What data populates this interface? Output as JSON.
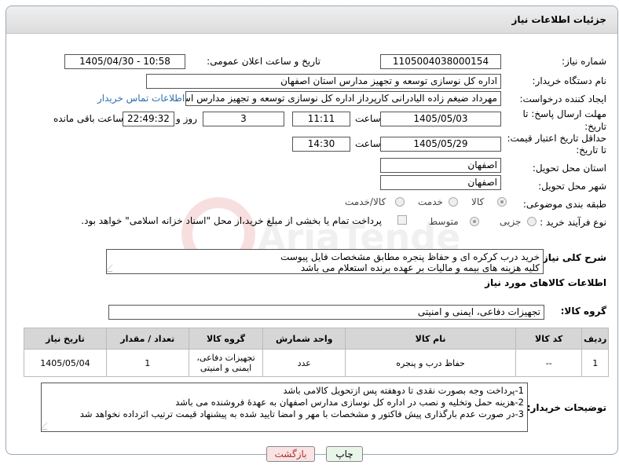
{
  "header": {
    "title": "جزئیات اطلاعات نیاز"
  },
  "fields": {
    "need_number_label": "شماره نیاز:",
    "need_number": "1105004038000154",
    "announce_label": "تاریخ و ساعت اعلان عمومی:",
    "announce_value": "1405/04/30 - 10:58",
    "buyer_org_label": "نام دستگاه خریدار:",
    "buyer_org": "اداره کل نوسازی  توسعه و تجهیز مدارس استان اصفهان",
    "creator_label": "ایجاد کننده درخواست:",
    "creator": "مهرداد ضیغم زاده الیادرانی کارپرداز اداره کل نوسازی  توسعه و تجهیز مدارس اس",
    "contact_link": "اطلاعات تماس خریدار",
    "reply_deadline_label_1": "مهلت ارسال پاسخ: تا",
    "reply_deadline_label_2": "تاریخ:",
    "reply_date": "1405/05/03",
    "time_label": "ساعت",
    "reply_time": "11:11",
    "days_value": "3",
    "days_label": "روز و",
    "remaining_time": "22:49:32",
    "remaining_label": "ساعت باقی مانده",
    "price_deadline_label_1": "حداقل تاریخ اعتبار قیمت:",
    "price_deadline_label_2": "تا تاریخ:",
    "price_date": "1405/05/29",
    "price_time_label": "ساعت",
    "price_time": "14:30",
    "province_label": "استان محل تحویل:",
    "province": "اصفهان",
    "city_label": "شهر محل تحویل:",
    "city": "اصفهان",
    "category_label": "طبقه بندی موضوعی:",
    "category_options": [
      "کالا",
      "خدمت",
      "کالا/خدمت"
    ],
    "process_label": "نوع فرآیند خرید :",
    "process_options": [
      "جزیی",
      "متوسط"
    ],
    "payment_note": "پرداخت تمام یا بخشی از مبلغ خرید،از محل \"اسناد خزانه اسلامی\" خواهد بود."
  },
  "description": {
    "label": "شرح کلی نیاز:",
    "lines": [
      "خرید درب کرکره ای و حفاظ پنجره مطابق مشخصات فایل پیوست",
      "کلیه هزینه های بیمه و مالیات بر عهده برنده استعلام می باشد"
    ]
  },
  "goods": {
    "section_title": "اطلاعات کالاهای مورد نیاز",
    "group_label": "گروه کالا:",
    "group_value": "تجهیزات دفاعی، ایمنی و امنیتی",
    "columns": [
      "ردیف",
      "کد کالا",
      "نام کالا",
      "واحد شمارش",
      "گروه کالا",
      "تعداد / مقدار",
      "تاریخ نیاز"
    ],
    "rows": [
      {
        "row": "1",
        "code": "--",
        "name": "حفاظ درب و پنجره",
        "unit": "عدد",
        "group_1": "تجهیزات دفاعی،",
        "group_2": "ایمنی و امنیتی",
        "qty": "1",
        "date": "1405/05/04"
      }
    ]
  },
  "buyer_notes": {
    "label": "توضیحات خریدار:",
    "lines": [
      "1-پرداخت وجه بصورت نقدی تا دوهفته پس ازتحویل کالامی باشد",
      "2-هزینه حمل وتخلیه و نصب در اداره کل نوسازی مدارس اصفهان به عهدهٔ فروشنده می باشد",
      "3-در صورت عدم بارگذاری پیش فاکتور و مشخصات با مهر و امضا تایید شده به پیشنهاد قیمت ترتیب اثرداده نخواهد شد"
    ]
  },
  "buttons": {
    "print": "چاپ",
    "back": "بازگشت"
  },
  "colors": {
    "link": "#2e6fb0",
    "print_bg": "#eaf5ea",
    "back_bg": "#f9e3e3"
  },
  "watermark": "AriaTender.net"
}
